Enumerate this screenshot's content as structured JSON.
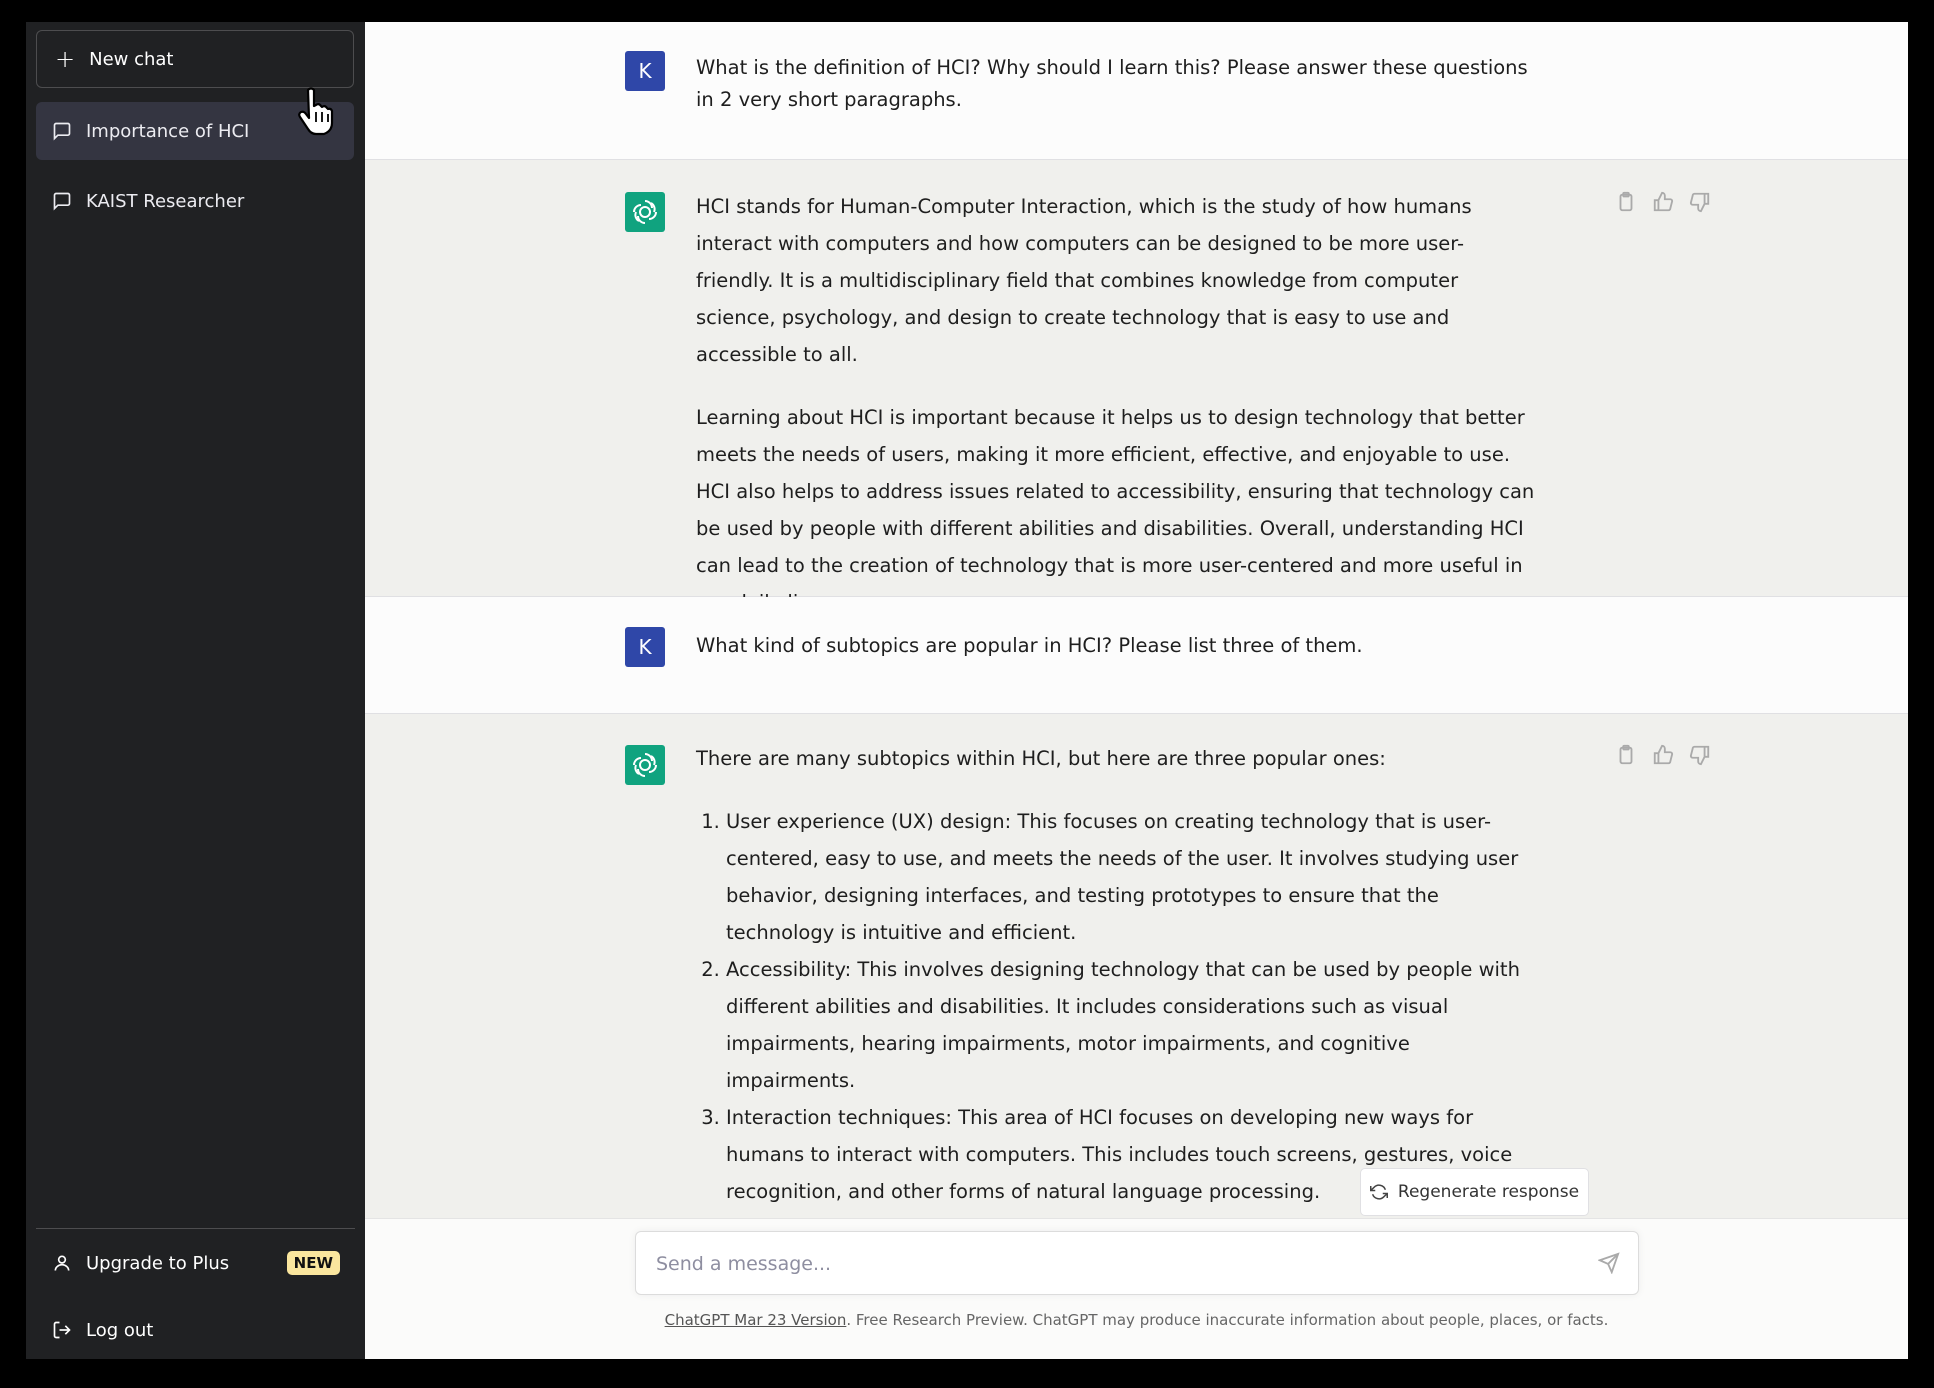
{
  "sidebar": {
    "new_chat_label": "New chat",
    "history": [
      {
        "label": "Importance of HCI",
        "active": true
      },
      {
        "label": "KAIST Researcher",
        "active": false
      }
    ],
    "upgrade_label": "Upgrade to Plus",
    "upgrade_badge": "NEW",
    "logout_label": "Log out"
  },
  "conversation": {
    "user_initial": "K",
    "messages": [
      {
        "role": "user",
        "text": "What is the definition of HCI? Why should I learn this? Please answer these questions in 2 very short paragraphs."
      },
      {
        "role": "assistant",
        "paragraphs": [
          "HCI stands for Human-Computer Interaction, which is the study of how humans interact with computers and how computers can be designed to be more user-friendly. It is a multidisciplinary field that combines knowledge from computer science, psychology, and design to create technology that is easy to use and accessible to all.",
          "Learning about HCI is important because it helps us to design technology that better meets the needs of users, making it more efficient, effective, and enjoyable to use. HCI also helps to address issues related to accessibility, ensuring that technology can be used by people with different abilities and disabilities. Overall, understanding HCI can lead to the creation of technology that is more user-centered and more useful in our daily lives."
        ]
      },
      {
        "role": "user",
        "text": "What kind of subtopics are popular in HCI? Please list three of them."
      },
      {
        "role": "assistant",
        "intro": "There are many subtopics within HCI, but here are three popular ones:",
        "list": [
          "User experience (UX) design: This focuses on creating technology that is user-centered, easy to use, and meets the needs of the user. It involves studying user behavior, designing interfaces, and testing prototypes to ensure that the technology is intuitive and efficient.",
          "Accessibility: This involves designing technology that can be used by people with different abilities and disabilities. It includes considerations such as visual impairments, hearing impairments, motor impairments, and cognitive impairments.",
          "Interaction techniques: This area of HCI focuses on developing new ways for humans to interact with computers. This includes touch screens, gestures, voice recognition, and other forms of natural language processing."
        ]
      }
    ]
  },
  "regenerate_label": "Regenerate response",
  "composer": {
    "placeholder": "Send a message..."
  },
  "footer": {
    "link_text": "ChatGPT Mar 23 Version",
    "text": ". Free Research Preview. ChatGPT may produce inaccurate information about people, places, or facts."
  },
  "colors": {
    "sidebar_bg": "#202123",
    "active_item": "#343541",
    "user_avatar": "#2f47a8",
    "gpt_avatar": "#10a37f",
    "badge": "#fae69e"
  }
}
